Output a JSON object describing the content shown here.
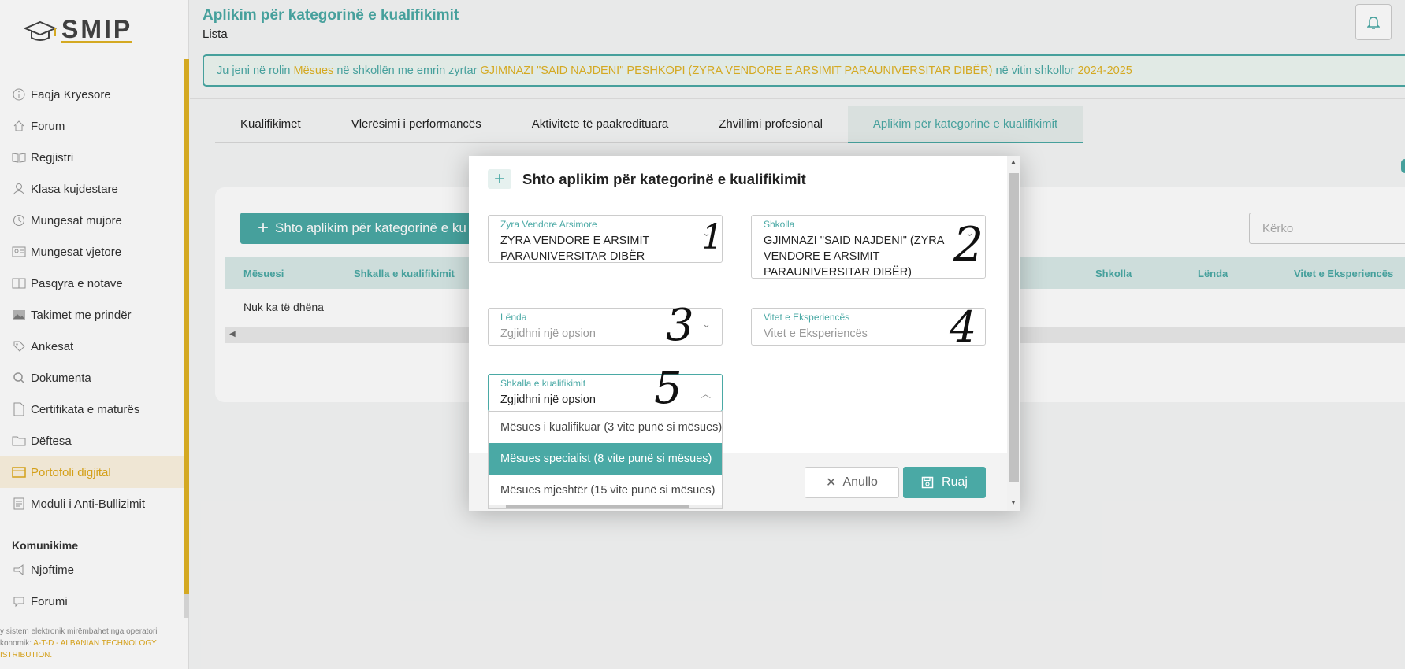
{
  "app": {
    "logo_text": "SMIP"
  },
  "sidebar": {
    "items": [
      {
        "label": "Faqja Kryesore",
        "icon": "info-icon"
      },
      {
        "label": "Forum",
        "icon": "home-icon"
      },
      {
        "label": "Regjistri",
        "icon": "book-icon"
      },
      {
        "label": "Klasa kujdestare",
        "icon": "users-icon"
      },
      {
        "label": "Mungesat mujore",
        "icon": "history-icon"
      },
      {
        "label": "Mungesat vjetore",
        "icon": "id-card-icon"
      },
      {
        "label": "Pasqyra e notave",
        "icon": "book-open-icon"
      },
      {
        "label": "Takimet me prindër",
        "icon": "image-icon"
      },
      {
        "label": "Ankesat",
        "icon": "tag-icon"
      },
      {
        "label": "Dokumenta",
        "icon": "search-icon"
      },
      {
        "label": "Certifikata e maturës",
        "icon": "file-icon"
      },
      {
        "label": "Dëftesa",
        "icon": "folder-icon"
      },
      {
        "label": "Portofoli digjital",
        "icon": "portfolio-icon",
        "active": true
      },
      {
        "label": "Moduli i Anti-Bullizimit",
        "icon": "document-icon"
      }
    ],
    "section_title": "Komunikime",
    "comm_items": [
      {
        "label": "Njoftime",
        "icon": "megaphone-icon"
      },
      {
        "label": "Forumi",
        "icon": "chat-icon"
      }
    ],
    "footer_prefix": "y sistem elektronik mirëmbahet nga operatori",
    "footer_prefix2": "konomik:",
    "footer_company": "A-T-D - ALBANIAN TECHNOLOGY",
    "footer_company2": "ISTRIBUTION."
  },
  "header": {
    "title": "Aplikim për kategorinë e kualifikimit",
    "subtitle": "Lista"
  },
  "banner": {
    "p1": "Ju jeni në rolin",
    "role": "Mësues",
    "p2": "në shkollën me emrin zyrtar",
    "school": "GJIMNAZI \"SAID NAJDENI\" PESHKOPI (ZYRA VENDORE E ARSIMIT PARAUNIVERSITAR DIBËR)",
    "p3": "në vitin shkollor",
    "year": "2024-2025"
  },
  "tabs": [
    {
      "label": "Kualifikimet"
    },
    {
      "label": "Vlerësimi i performancës"
    },
    {
      "label": "Aktivitete të paakredituara"
    },
    {
      "label": "Zhvillimi profesional"
    },
    {
      "label": "Aplikim për kategorinë e kualifikimit",
      "active": true
    }
  ],
  "list": {
    "add_button": "Shto aplikim për kategorinë e ku",
    "search_placeholder": "Kërko",
    "columns": [
      "Mësuesi",
      "Shkalla e kualifikimit",
      "Shkolla",
      "Lënda",
      "Vitet e Eksperiencës"
    ],
    "empty": "Nuk ka të dhëna"
  },
  "modal": {
    "title": "Shto aplikim për kategorinë e kualifikimit",
    "fields": {
      "zyra": {
        "label": "Zyra Vendore Arsimore",
        "line1": "ZYRA VENDORE E ARSIMIT",
        "line2": "PARAUNIVERSITAR DIBËR"
      },
      "shkolla": {
        "label": "Shkolla",
        "line1": "GJIMNAZI \"SAID NAJDENI\" (ZYRA",
        "line2": "VENDORE E ARSIMIT",
        "line3": "PARAUNIVERSITAR DIBËR)"
      },
      "lenda": {
        "label": "Lënda",
        "placeholder": "Zgjidhni një opsion"
      },
      "vitet": {
        "label": "Vitet e Eksperiencës",
        "placeholder": "Vitet e Eksperiencës"
      },
      "shkalla": {
        "label": "Shkalla e kualifikimit",
        "value": "Zgjidhni një opsion"
      }
    },
    "options": [
      {
        "label": "Mësues i kualifikuar (3 vite punë si mësues)"
      },
      {
        "label": "Mësues specialist (8 vite punë si mësues)",
        "highlighted": true
      },
      {
        "label": "Mësues mjeshtër (15 vite punë si mësues)"
      }
    ],
    "cancel_label": "Anullo",
    "save_label": "Ruaj"
  },
  "annotations": [
    "1",
    "2",
    "3",
    "4",
    "5"
  ],
  "colors": {
    "accent": "#4aa9a5",
    "gold": "#e0b324"
  }
}
